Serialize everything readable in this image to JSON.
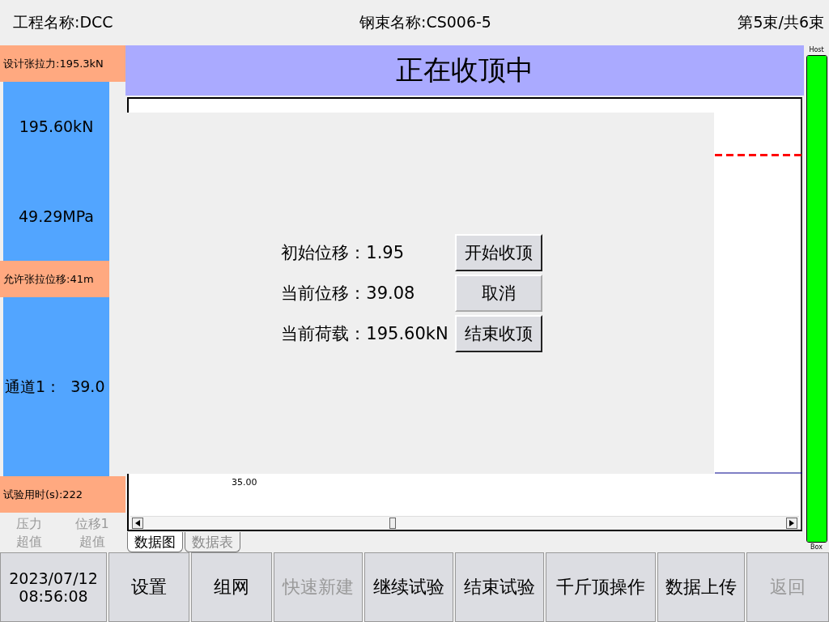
{
  "header": {
    "project": "工程名称:DCC",
    "strand": "钢束名称:CS006-5",
    "count": "第5束/共6束"
  },
  "left_panel": {
    "design_force": "设计张拉力:195.3kN",
    "force": "195.60kN",
    "stress": "49.29MPa",
    "allowed_displacement": "允许张拉位移:41m",
    "channel": "通道1：  39.0",
    "elapsed": "试验用时(s):222",
    "alarms": [
      {
        "lines": [
          "压力",
          "超值"
        ],
        "active": false
      },
      {
        "lines": [
          "位移1",
          "超值"
        ],
        "active": false
      }
    ]
  },
  "status_title": "正在收顶中",
  "chart": {
    "tick_label": "35.00"
  },
  "tabs": [
    {
      "label": "数据图",
      "selected": true
    },
    {
      "label": "数据表",
      "selected": false
    }
  ],
  "meter": {
    "top_label": "Host",
    "bottom_label": "Box",
    "level": 1
  },
  "dialog": {
    "rows": [
      {
        "label": "初始位移：1.95",
        "button": "开始收顶",
        "emphasized": true
      },
      {
        "label": "当前位移：39.08",
        "button": "取消",
        "emphasized": false
      },
      {
        "label": "当前荷载：195.60kN",
        "button": "结束收顶",
        "emphasized": true
      }
    ]
  },
  "clock": {
    "date": "2023/07/12",
    "time": "08:56:08"
  },
  "toolbar": [
    {
      "label": "设置",
      "disabled": false
    },
    {
      "label": "组网",
      "disabled": false
    },
    {
      "label": "快速新建",
      "disabled": true
    },
    {
      "label": "继续试验",
      "disabled": false
    },
    {
      "label": "结束试验",
      "disabled": false
    },
    {
      "label": "千斤顶操作",
      "disabled": false
    },
    {
      "label": "数据上传",
      "disabled": false
    },
    {
      "label": "返回",
      "disabled": true
    }
  ]
}
